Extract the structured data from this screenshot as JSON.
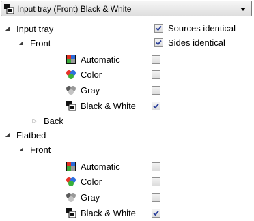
{
  "dropdown": {
    "selected": "Input tray (Front) Black & White"
  },
  "top_options": [
    {
      "label": "Sources identical",
      "checked": true
    },
    {
      "label": "Sides identical",
      "checked": true
    }
  ],
  "tree": {
    "input_tray": {
      "label": "Input tray",
      "front": {
        "label": "Front",
        "items": [
          {
            "label": "Automatic",
            "icon": "automatic-icon",
            "checked": false
          },
          {
            "label": "Color",
            "icon": "color-icon",
            "checked": false
          },
          {
            "label": "Gray",
            "icon": "gray-icon",
            "checked": false
          },
          {
            "label": "Black & White",
            "icon": "black-white-icon",
            "checked": true
          }
        ]
      },
      "back": {
        "label": "Back"
      }
    },
    "flatbed": {
      "label": "Flatbed",
      "front": {
        "label": "Front",
        "items": [
          {
            "label": "Automatic",
            "icon": "automatic-icon",
            "checked": false
          },
          {
            "label": "Color",
            "icon": "color-icon",
            "checked": false
          },
          {
            "label": "Gray",
            "icon": "gray-icon",
            "checked": false
          },
          {
            "label": "Black & White",
            "icon": "black-white-icon",
            "checked": true
          }
        ]
      }
    }
  },
  "colors": {
    "checkmark": "#2a3f9a",
    "checkbox_border": "#8f8f8f"
  }
}
